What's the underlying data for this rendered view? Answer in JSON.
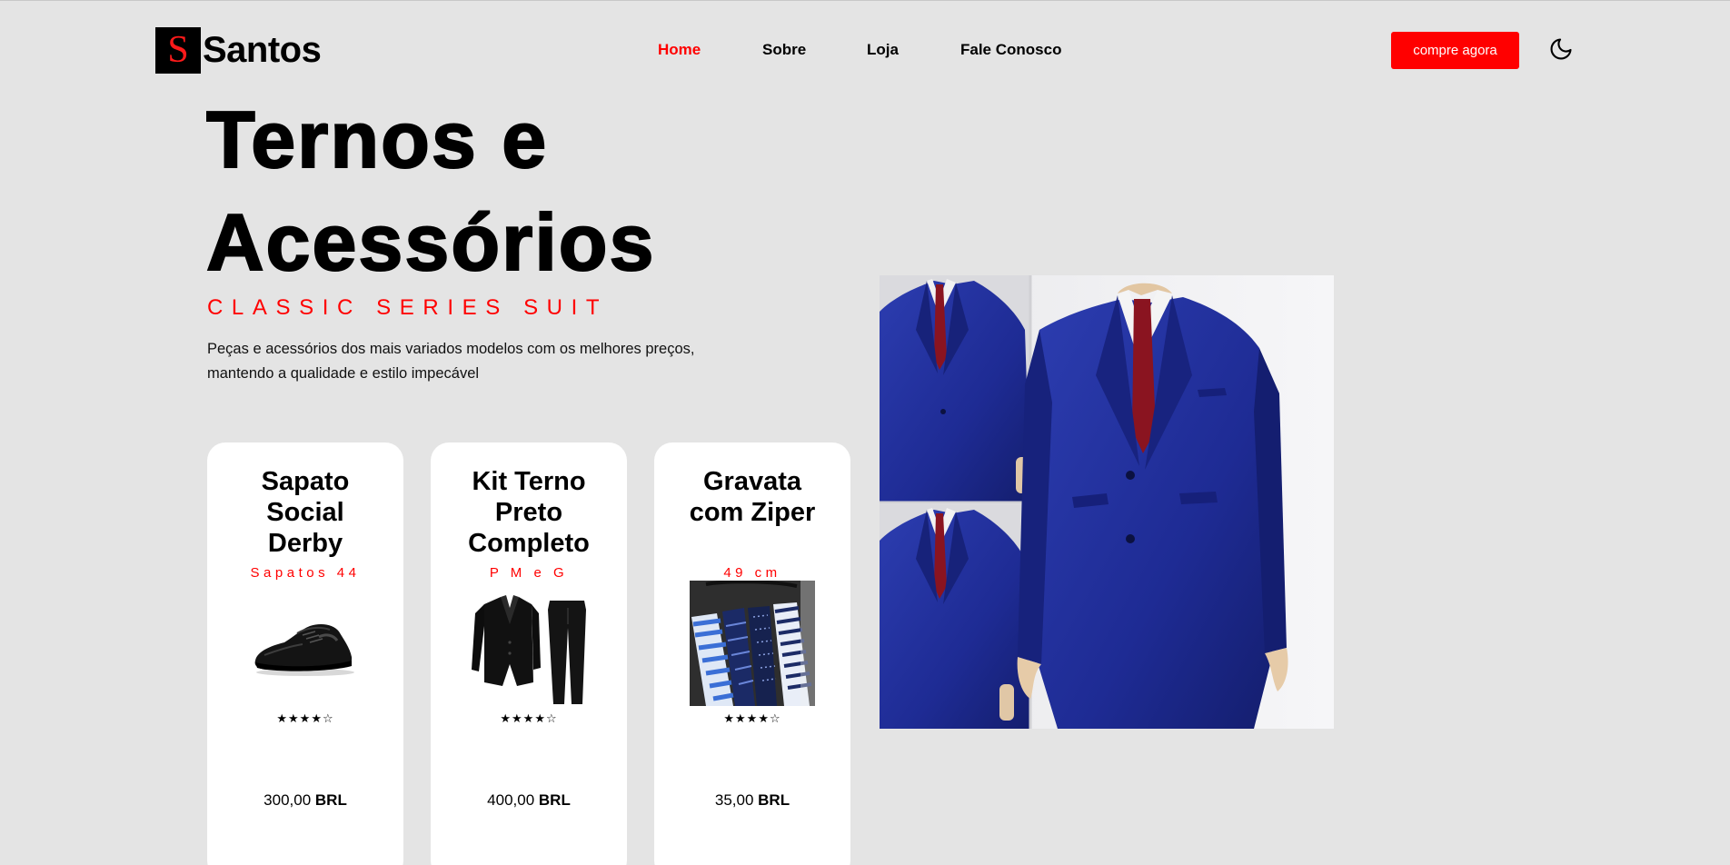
{
  "brand": {
    "logo_letter": "S",
    "name": "Santos"
  },
  "nav": {
    "items": [
      {
        "label": "Home",
        "active": true
      },
      {
        "label": "Sobre",
        "active": false
      },
      {
        "label": "Loja",
        "active": false
      },
      {
        "label": "Fale Conosco",
        "active": false
      }
    ],
    "cta_label": "compre agora",
    "theme_icon": "moon-icon"
  },
  "hero": {
    "title_line1": "Ternos e",
    "title_line2": "Acessórios",
    "subtitle": "CLASSIC SERIES SUIT",
    "description": "Peças e acessórios dos mais variados modelos com os melhores preços, mantendo a qualidade e estilo impecável"
  },
  "products": [
    {
      "name": "Sapato Social Derby",
      "tag": "Sapatos 44",
      "image": "black-shoe-image",
      "rating": "★★★★☆",
      "price": "300,00",
      "currency": "BRL"
    },
    {
      "name": "Kit Terno Preto Completo",
      "tag": "P M e G",
      "image": "black-suit-image",
      "rating": "★★★★☆",
      "price": "400,00",
      "currency": "BRL"
    },
    {
      "name": "Gravata com Ziper",
      "tag": "49 cm",
      "image": "ties-image",
      "rating": "★★★★☆",
      "price": "35,00",
      "currency": "BRL"
    }
  ],
  "colors": {
    "accent": "#ff0000",
    "background": "#e4e4e4",
    "card": "#ffffff",
    "suit_blue": "#1f2f99",
    "tie_red": "#8a1420"
  }
}
